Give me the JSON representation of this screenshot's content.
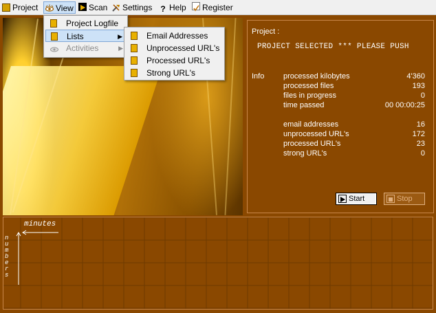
{
  "menubar": {
    "items": [
      {
        "label": "Project",
        "icon": "folder-icon"
      },
      {
        "label": "View",
        "icon": "eye-icon"
      },
      {
        "label": "Scan",
        "icon": "play-icon"
      },
      {
        "label": "Settings",
        "icon": "tools-icon"
      },
      {
        "label": "Help",
        "icon": "question-icon"
      },
      {
        "label": "Register",
        "icon": "checkbox-icon"
      }
    ]
  },
  "view_menu": {
    "items": [
      {
        "label": "Project Logfile"
      },
      {
        "label": "Lists"
      },
      {
        "label": "Activities"
      }
    ]
  },
  "lists_submenu": {
    "items": [
      {
        "label": "Email Addresses"
      },
      {
        "label": "Unprocessed URL's"
      },
      {
        "label": "Processed URL's"
      },
      {
        "label": "Strong URL's"
      }
    ]
  },
  "project": {
    "label": "Project :",
    "selected_text": "PROJECT SELECTED  ***  PLEASE PUSH",
    "info_label": "Info"
  },
  "stats": [
    {
      "label": "processed kilobytes",
      "value": "4'360"
    },
    {
      "label": "processed files",
      "value": "193"
    },
    {
      "label": "files in progress",
      "value": "0"
    },
    {
      "label": "time passed",
      "value": "00 00:00:25"
    },
    {
      "label": "email addresses",
      "value": "16"
    },
    {
      "label": "unprocessed URL's",
      "value": "172"
    },
    {
      "label": "processed URL's",
      "value": "23"
    },
    {
      "label": "strong URL's",
      "value": "0"
    }
  ],
  "buttons": {
    "start": "Start",
    "stop": "Stop"
  },
  "chart": {
    "xlabel": "minutes",
    "ylabel": "numbers"
  },
  "colors": {
    "background": "#8a4800",
    "grid": "#6e3a00",
    "text": "#ffffff",
    "highlight": "#cde2f7"
  }
}
